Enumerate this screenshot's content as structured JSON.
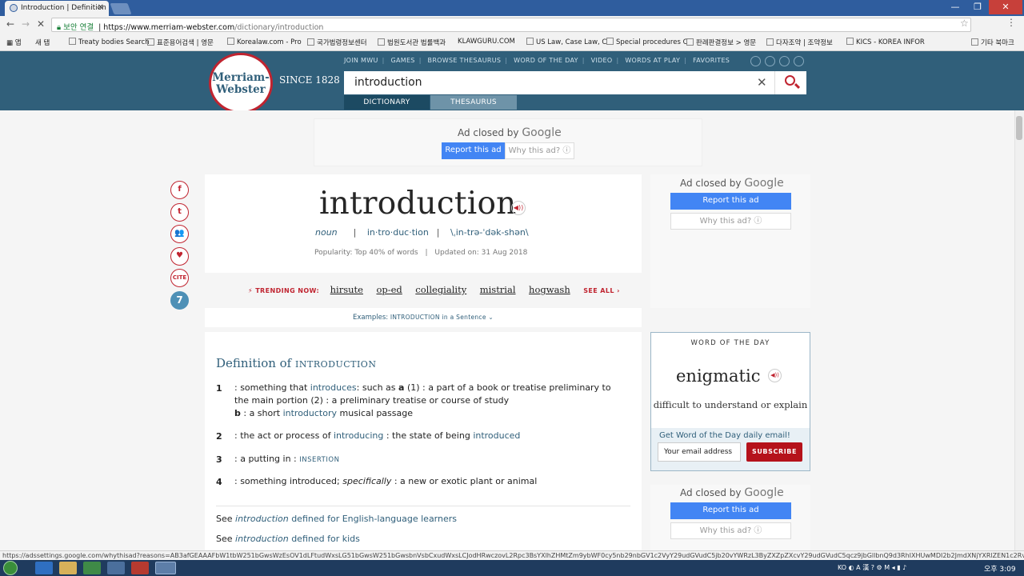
{
  "browser": {
    "tab_title": "Introduction | Definition",
    "tab_close": "✕",
    "secure_label": "보안 연결",
    "url_host": "https://www.merriam-webster.com",
    "url_path": "/dictionary/introduction",
    "window_buttons": {
      "minimize": "—",
      "maximize": "❐",
      "close": "✕"
    },
    "bookmarks": [
      "앱",
      "새 탭",
      "Treaty bodies Search",
      "표준용어검색 | 영문",
      "Korealaw.com - Pro",
      "국가법령정보센터",
      "법원도서관 법률백과",
      "KLAWGURU.COM",
      "US Law, Case Law, C",
      "Special procedures C",
      "판례판결정보 > 영문",
      "다자조약 | 조약정보",
      "KICS - KOREA INFOR",
      "기타 북마크"
    ],
    "status_url": "https://adssettings.google.com/whythisad?reasons=AB3afGEAAAFbW1tbW251bGwsWzEsOV1dLFtudWxsLG51bGwsW251bGwsbnVsbCxudWxsLCJodHRwczovL2Rpc3BsYXlhZHMtZm9ybWF0cy5nb29nbGV1c2VyY29udGVudC5jb20vYWRzL3ByZXZpZXcvY29udGVudC5qcz9jbGllbnQ9d3RhIXHUwMDI2b2JmdXNjYXRlZEN1c2RvbWVySWQ9NTc3MTQ3OTc"
  },
  "site": {
    "logo_line1": "Merriam-",
    "logo_line2": "Webster",
    "since": "SINCE 1828",
    "nav": [
      "JOIN MWU",
      "GAMES",
      "BROWSE THESAURUS",
      "WORD OF THE DAY",
      "VIDEO",
      "WORDS AT PLAY",
      "FAVORITES"
    ],
    "search_value": "introduction",
    "search_clear": "✕",
    "tab_dictionary": "DICTIONARY",
    "tab_thesaurus": "THESAURUS"
  },
  "ads": {
    "closed_prefix": "Ad closed by",
    "closed_brand": "Google",
    "report": "Report this ad",
    "why": "Why this ad? ⓘ"
  },
  "share": [
    "f",
    "t",
    "👥",
    "♥",
    "CITE",
    "7"
  ],
  "entry": {
    "headword": "introduction",
    "pos": "noun",
    "syllables": "in·tro·duc·tion",
    "pronunciation": "\\ˌin-trə-ˈdək-shən\\",
    "popularity": "Popularity: Top 40% of words",
    "updated": "Updated on: 31 Aug 2018"
  },
  "trending": {
    "label": "TRENDING NOW:",
    "words": [
      "hirsute",
      "op-ed",
      "collegiality",
      "mistrial",
      "hogwash"
    ],
    "see_all": "SEE ALL ›"
  },
  "examples": {
    "prefix": "Examples:",
    "label": "INTRODUCTION in a Sentence ⌄"
  },
  "definition": {
    "title": "Definition of",
    "word_sc": "INTRODUCTION",
    "senses": [
      {
        "num": "1",
        "p1": ": something that ",
        "l1": "introduces",
        "p2": ": such as ",
        "b1": "a",
        "p3": " (1) : a part of a book or treatise preliminary to the main portion (2) : a preliminary treatise or course of study",
        "b2": "b",
        "p4": " : a short ",
        "l2": "introductory",
        "p5": " musical passage"
      },
      {
        "num": "2",
        "p1": ": the act or process of ",
        "l1": "introducing",
        "p2": " : the state of being ",
        "l2": "introduced"
      },
      {
        "num": "3",
        "p1": ": a putting in : ",
        "l1": "INSERTION"
      },
      {
        "num": "4",
        "p1": ": something introduced; ",
        "i1": "specifically",
        "p2": " : a new or exotic plant or animal"
      }
    ],
    "see1_prefix": "See",
    "see1_link": "introduction",
    "see1_suffix": "defined for English-language learners",
    "see2_prefix": "See",
    "see2_link": "introduction",
    "see2_suffix": "defined for kids"
  },
  "wotd": {
    "heading": "WORD OF THE DAY",
    "word": "enigmatic",
    "definition": "difficult to understand or explain",
    "email_label": "Get Word of the Day daily email!",
    "email_placeholder": "Your email address",
    "subscribe": "SUBSCRIBE"
  },
  "taskbar": {
    "tray": "KO  ◐ A 漢 ? ⚙  M  ◂ ▮ ♪",
    "clock": "오후 3:09"
  }
}
